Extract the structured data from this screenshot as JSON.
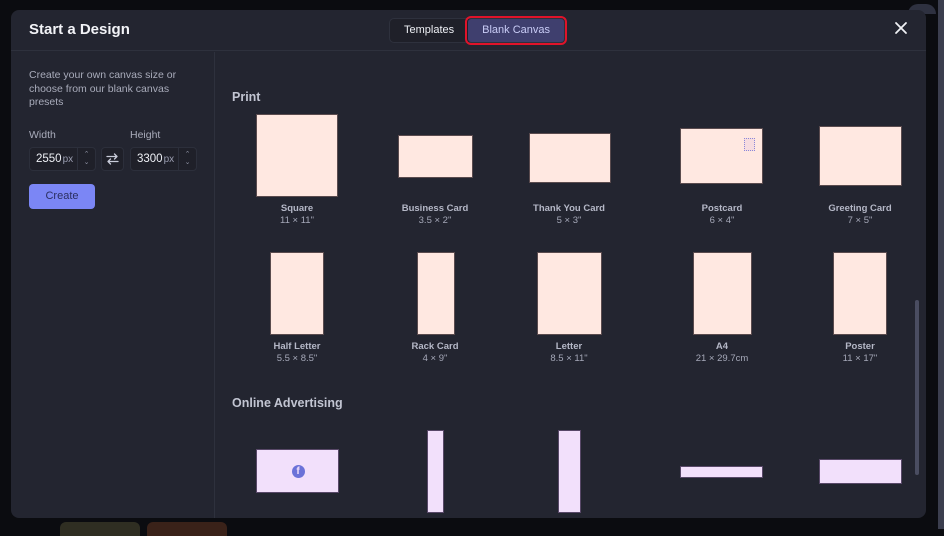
{
  "modal": {
    "title": "Start a Design",
    "tabs": [
      {
        "label": "Templates",
        "active": false
      },
      {
        "label": "Blank Canvas",
        "active": true
      }
    ],
    "close_icon": "close-icon"
  },
  "sidebar": {
    "description": "Create your own canvas size or choose from our blank canvas presets",
    "width": {
      "label": "Width",
      "value": "2550",
      "unit": "px"
    },
    "height": {
      "label": "Height",
      "value": "3300",
      "unit": "px"
    },
    "swap_icon": "swap-arrows-icon",
    "create_label": "Create"
  },
  "sections": {
    "print": {
      "title": "Print",
      "presets": [
        {
          "name": "Square",
          "size": "11 × 11\""
        },
        {
          "name": "Business Card",
          "size": "3.5 × 2\""
        },
        {
          "name": "Thank You Card",
          "size": "5 × 3\""
        },
        {
          "name": "Postcard",
          "size": "6 × 4\""
        },
        {
          "name": "Greeting Card",
          "size": "7 × 5\""
        },
        {
          "name": "Half Letter",
          "size": "5.5 × 8.5\""
        },
        {
          "name": "Rack Card",
          "size": "4 × 9\""
        },
        {
          "name": "Letter",
          "size": "8.5 × 11\""
        },
        {
          "name": "A4",
          "size": "21 × 29.7cm"
        },
        {
          "name": "Poster",
          "size": "11 × 17\""
        }
      ]
    },
    "online_advertising": {
      "title": "Online Advertising",
      "facebook_glyph": "f"
    }
  },
  "colors": {
    "accent": "#7b86f5",
    "print_thumb": "#ffe8e1",
    "ad_thumb": "#f2e0fb",
    "highlight_outline": "#e0132a"
  }
}
